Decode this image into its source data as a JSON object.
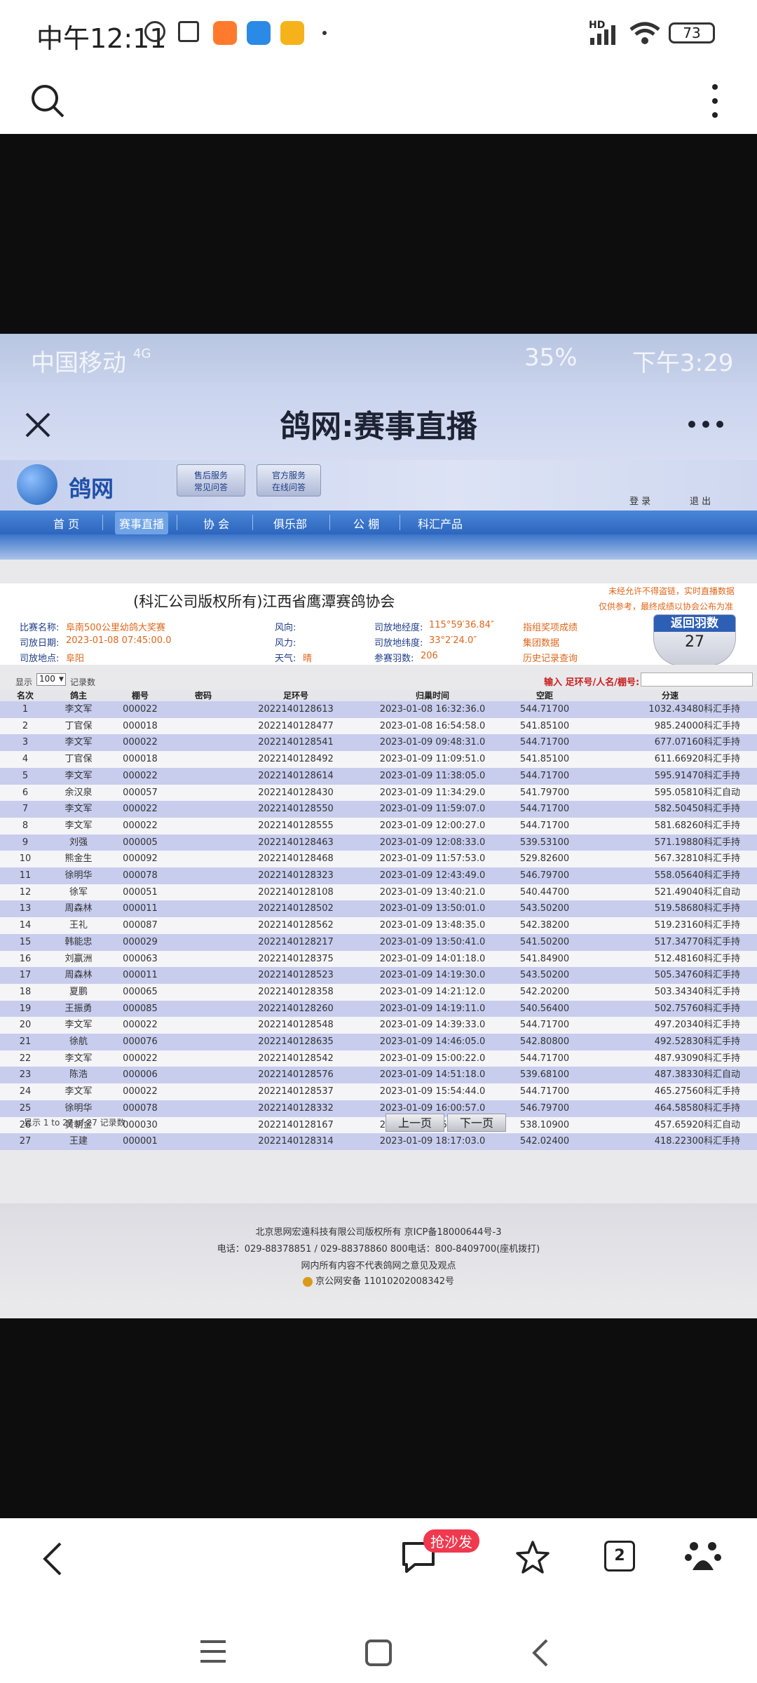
{
  "status_bar": {
    "time": "中午12:11",
    "network": "HD",
    "battery": "73"
  },
  "inner_status": {
    "carrier": "中国移动",
    "network": "4G",
    "battery_pct": "35%",
    "time": "下午3:29"
  },
  "inner_header": {
    "title": "鸽网:赛事直播"
  },
  "site": {
    "logo_text": "鸽网",
    "badge1_line1": "售后服务",
    "badge1_line2": "常见问答",
    "badge2_line1": "官方服务",
    "badge2_line2": "在线问答",
    "login": "登 录",
    "logout": "退 出",
    "nav": [
      "首 页",
      "赛事直播",
      "协 会",
      "俱乐部",
      "公 棚",
      "科汇产品"
    ]
  },
  "race": {
    "title": "(科汇公司版权所有)江西省鹰潭赛鸽协会",
    "notice1": "未经允许不得盗链，实时直播数据",
    "notice2": "仅供参考，最终成绩以协会公布为准",
    "name_label": "比赛名称:",
    "name": "阜南500公里幼鸽大奖赛",
    "date_label": "司放日期:",
    "date": "2023-01-08 07:45:00.0",
    "place_label": "司放地点:",
    "place": "阜阳",
    "wind_dir_label": "风向:",
    "wind_label": "风力:",
    "weather_label": "天气:",
    "weather": "晴",
    "lon_label": "司放地经度:",
    "lon": "115°59′36.84″",
    "lat_label": "司放地纬度:",
    "lat": "33°2′24.0″",
    "count_label": "参赛羽数:",
    "count": "206",
    "link1": "指组奖项成绩",
    "link2": "集团数据",
    "link3": "历史记录查询",
    "return_label": "返回羽数",
    "return_count": "27"
  },
  "table_controls": {
    "show": "显示",
    "page_size": "100",
    "records": "记录数",
    "search_label": "输入 足环号/人名/棚号:"
  },
  "columns": [
    "名次",
    "鸽主",
    "棚号",
    "密码",
    "足环号",
    "归巢时间",
    "空距",
    "分速"
  ],
  "rows": [
    [
      "1",
      "李文军",
      "000022",
      "",
      "2022140128613",
      "2023-01-08 16:32:36.0",
      "544.71700",
      "1032.43480科汇手持"
    ],
    [
      "2",
      "丁官保",
      "000018",
      "",
      "2022140128477",
      "2023-01-08 16:54:58.0",
      "541.85100",
      "985.24000科汇手持"
    ],
    [
      "3",
      "李文军",
      "000022",
      "",
      "2022140128541",
      "2023-01-09 09:48:31.0",
      "544.71700",
      "677.07160科汇手持"
    ],
    [
      "4",
      "丁官保",
      "000018",
      "",
      "2022140128492",
      "2023-01-09 11:09:51.0",
      "541.85100",
      "611.66920科汇手持"
    ],
    [
      "5",
      "李文军",
      "000022",
      "",
      "2022140128614",
      "2023-01-09 11:38:05.0",
      "544.71700",
      "595.91470科汇手持"
    ],
    [
      "6",
      "余汉泉",
      "000057",
      "",
      "2022140128430",
      "2023-01-09 11:34:29.0",
      "541.79700",
      "595.05810科汇自动"
    ],
    [
      "7",
      "李文军",
      "000022",
      "",
      "2022140128550",
      "2023-01-09 11:59:07.0",
      "544.71700",
      "582.50450科汇手持"
    ],
    [
      "8",
      "李文军",
      "000022",
      "",
      "2022140128555",
      "2023-01-09 12:00:27.0",
      "544.71700",
      "581.68260科汇手持"
    ],
    [
      "9",
      "刘强",
      "000005",
      "",
      "2022140128463",
      "2023-01-09 12:08:33.0",
      "539.53100",
      "571.19880科汇手持"
    ],
    [
      "10",
      "熊金生",
      "000092",
      "",
      "2022140128468",
      "2023-01-09 11:57:53.0",
      "529.82600",
      "567.32810科汇手持"
    ],
    [
      "11",
      "徐明华",
      "000078",
      "",
      "2022140128323",
      "2023-01-09 12:43:49.0",
      "546.79700",
      "558.05640科汇手持"
    ],
    [
      "12",
      "徐军",
      "000051",
      "",
      "2022140128108",
      "2023-01-09 13:40:21.0",
      "540.44700",
      "521.49040科汇自动"
    ],
    [
      "13",
      "周森林",
      "000011",
      "",
      "2022140128502",
      "2023-01-09 13:50:01.0",
      "543.50200",
      "519.58680科汇手持"
    ],
    [
      "14",
      "王礼",
      "000087",
      "",
      "2022140128562",
      "2023-01-09 13:48:35.0",
      "542.38200",
      "519.23160科汇手持"
    ],
    [
      "15",
      "韩能忠",
      "000029",
      "",
      "2022140128217",
      "2023-01-09 13:50:41.0",
      "541.50200",
      "517.34770科汇手持"
    ],
    [
      "16",
      "刘嬴洲",
      "000063",
      "",
      "2022140128375",
      "2023-01-09 14:01:18.0",
      "541.84900",
      "512.48160科汇手持"
    ],
    [
      "17",
      "周森林",
      "000011",
      "",
      "2022140128523",
      "2023-01-09 14:19:30.0",
      "543.50200",
      "505.34760科汇手持"
    ],
    [
      "18",
      "夏鹏",
      "000065",
      "",
      "2022140128358",
      "2023-01-09 14:21:12.0",
      "542.20200",
      "503.34340科汇手持"
    ],
    [
      "19",
      "王振勇",
      "000085",
      "",
      "2022140128260",
      "2023-01-09 14:19:11.0",
      "540.56400",
      "502.75760科汇手持"
    ],
    [
      "20",
      "李文军",
      "000022",
      "",
      "2022140128548",
      "2023-01-09 14:39:33.0",
      "544.71700",
      "497.20340科汇手持"
    ],
    [
      "21",
      "徐航",
      "000076",
      "",
      "2022140128635",
      "2023-01-09 14:46:05.0",
      "542.80800",
      "492.52830科汇手持"
    ],
    [
      "22",
      "李文军",
      "000022",
      "",
      "2022140128542",
      "2023-01-09 15:00:22.0",
      "544.71700",
      "487.93090科汇手持"
    ],
    [
      "23",
      "陈浩",
      "000006",
      "",
      "2022140128576",
      "2023-01-09 14:51:18.0",
      "539.68100",
      "487.38330科汇自动"
    ],
    [
      "24",
      "李文军",
      "000022",
      "",
      "2022140128537",
      "2023-01-09 15:54:44.0",
      "544.71700",
      "465.27560科汇手持"
    ],
    [
      "25",
      "徐明华",
      "000078",
      "",
      "2022140128332",
      "2023-01-09 16:00:57.0",
      "546.79700",
      "464.58580科汇手持"
    ],
    [
      "26",
      "黄朝金",
      "000030",
      "",
      "2022140128167",
      "2023-01-09 15:59:47.0",
      "538.10900",
      "457.65920科汇自动"
    ],
    [
      "27",
      "王建",
      "000001",
      "",
      "2022140128314",
      "2023-01-09 18:17:03.0",
      "542.02400",
      "418.22300科汇手持"
    ]
  ],
  "pagination": {
    "summary": "显示 1 to 27 of 27 记录数",
    "prev": "上一页",
    "next": "下一页"
  },
  "footer": {
    "line1": "北京思网宏遠科技有限公司版权所有 京ICP备18000644号-3",
    "line2": "电话：029-88378851 / 029-88378860   800电话：800-8409700(座机拨打)",
    "line3": "网内所有内容不代表鸽网之意见及观点",
    "line4": "京公网安备 11010202008342号"
  },
  "browser_bottom": {
    "promo": "抢沙发",
    "tab_count": "2"
  },
  "colors": {
    "nav_blue": "#2c66be",
    "orange": "#e0661a",
    "row_odd": "#c8cdee",
    "black": "#0d0d0d"
  }
}
